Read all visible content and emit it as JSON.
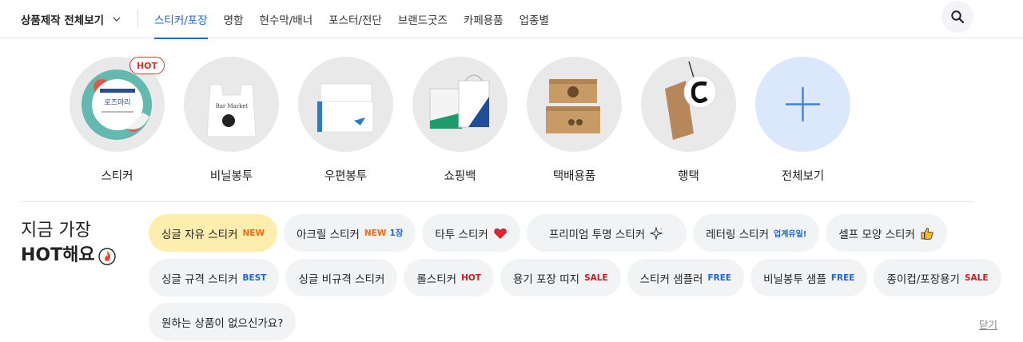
{
  "nav": {
    "all_menu_label": "상품제작 전체보기",
    "tabs": [
      {
        "label": "스티커/포장",
        "active": true
      },
      {
        "label": "명함"
      },
      {
        "label": "현수막/배너"
      },
      {
        "label": "포스터/전단"
      },
      {
        "label": "브랜드굿즈"
      },
      {
        "label": "카페용품"
      },
      {
        "label": "업종별"
      }
    ],
    "search_icon": "search-icon"
  },
  "categories": [
    {
      "label": "스티커",
      "badge": "HOT",
      "sticker_text": "로즈마리"
    },
    {
      "label": "비닐봉투",
      "bag_text": "Bar Market"
    },
    {
      "label": "우편봉투"
    },
    {
      "label": "쇼핑백"
    },
    {
      "label": "택배용품"
    },
    {
      "label": "행택"
    },
    {
      "label": "전체보기",
      "icon": "plus-icon"
    }
  ],
  "hot": {
    "title_line1": "지금 가장",
    "title_line2": "HOT해요",
    "title_icon": "fire-icon",
    "chips_row1": [
      {
        "label": "싱글 자유 스티커",
        "tag": "NEW"
      },
      {
        "label": "아크릴 스티커",
        "tag": "NEW",
        "tag2": "1장"
      },
      {
        "label": "타투 스티커",
        "icon": "heart-icon"
      },
      {
        "label": "프리미엄 투명 스티커",
        "icon": "sparkle-icon"
      },
      {
        "label": "레터링 스티커",
        "tag": "업계유일!"
      },
      {
        "label": "셀프 모양 스티커",
        "icon": "thumbs-up-icon"
      }
    ],
    "chips_row2": [
      {
        "label": "싱글 규격 스티커",
        "tag": "BEST"
      },
      {
        "label": "싱글 비규격 스티커"
      },
      {
        "label": "롤스티커",
        "tag": "HOT"
      },
      {
        "label": "용기 포장 띠지",
        "tag": "SALE"
      },
      {
        "label": "스티커 샘플러",
        "tag": "FREE"
      },
      {
        "label": "비닐봉투 샘플",
        "tag": "FREE"
      },
      {
        "label": "종이컵/포장용기",
        "tag": "SALE"
      }
    ],
    "chips_row3": [
      {
        "label": "원하는 상품이 없으신가요?"
      }
    ],
    "close_label": "닫기"
  },
  "colors": {
    "accent": "#1e66d6",
    "highlight_chip": "#fdeeae",
    "hot_red": "#e0302c",
    "new_orange": "#f06a14"
  }
}
